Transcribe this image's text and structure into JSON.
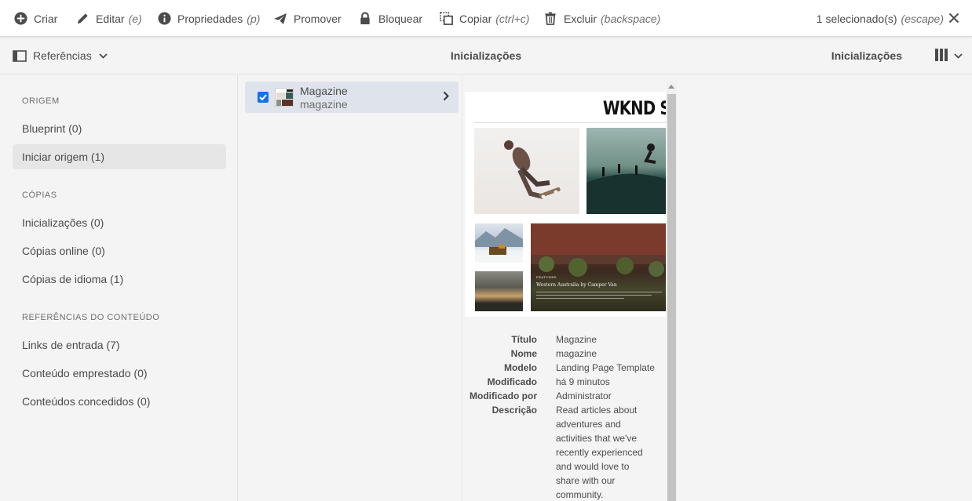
{
  "actionbar": {
    "create": "Criar",
    "edit": "Editar",
    "edit_hint": "(e)",
    "properties": "Propriedades",
    "properties_hint": "(p)",
    "promote": "Promover",
    "lock": "Bloquear",
    "copy": "Copiar",
    "copy_hint": "(ctrl+c)",
    "delete": "Excluir",
    "delete_hint": "(backspace)",
    "selection": "1 selecionado(s)",
    "selection_hint": "(escape)"
  },
  "header": {
    "rail_toggle_label": "Referências",
    "center_title": "Inicializações",
    "right_title": "Inicializações",
    "view_icon": "column-view-icon"
  },
  "rail": {
    "groups": [
      {
        "heading": "ORIGEM",
        "items": [
          "Blueprint (0)",
          "Iniciar origem (1)"
        ]
      },
      {
        "heading": "CÓPIAS",
        "items": [
          "Inicializações (0)",
          "Cópias online (0)",
          "Cópias de idioma (1)"
        ]
      },
      {
        "heading": "REFERÊNCIAS DO CONTEÚDO",
        "items": [
          "Links de entrada (7)",
          "Conteúdo emprestado (0)",
          "Conteúdos concedidos (0)"
        ]
      }
    ],
    "active_item": "Iniciar origem (1)"
  },
  "column": {
    "item": {
      "title": "Magazine",
      "name": "magazine",
      "selected": true
    }
  },
  "preview": {
    "brand": "WKND S",
    "feature_kicker": "FEATURED",
    "feature_title": "Western Australia by Camper Van"
  },
  "properties": [
    {
      "key": "Título",
      "value": "Magazine"
    },
    {
      "key": "Nome",
      "value": "magazine"
    },
    {
      "key": "Modelo",
      "value": "Landing Page Template"
    },
    {
      "key": "Modificado",
      "value": "há 9 minutos"
    },
    {
      "key": "Modificado por",
      "value": "Administrator"
    },
    {
      "key": "Descrição",
      "value": "Read articles about adventures and activities that we've recently experienced and would love to share with our community."
    }
  ],
  "colors": {
    "accent": "#1473e6",
    "selected_row": "#dfe4ec",
    "active_rail_item": "#e6e6e6"
  }
}
